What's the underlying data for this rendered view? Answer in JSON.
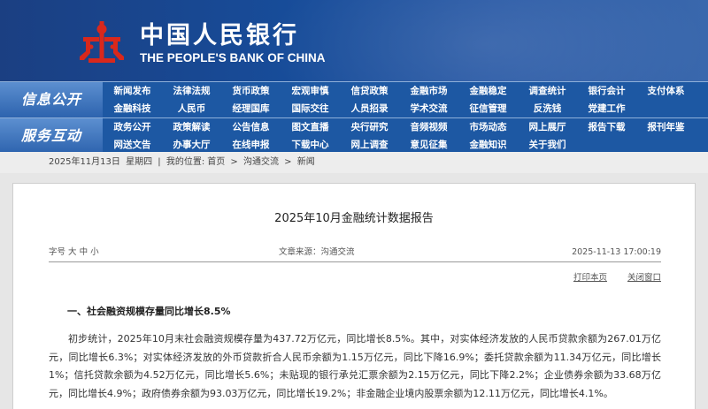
{
  "header": {
    "cn_name": "中国人民银行",
    "en_name": "THE PEOPLE'S BANK OF CHINA"
  },
  "nav": {
    "row1_label": "信息公开",
    "row2_label": "服务互动",
    "row1_items": [
      [
        "新闻发布",
        "法律法规",
        "货币政策",
        "宏观审慎",
        "信贷政策",
        "金融市场",
        "金融稳定",
        "调查统计",
        "银行会计",
        "支付体系"
      ],
      [
        "金融科技",
        "人民币",
        "经理国库",
        "国际交往",
        "人员招录",
        "学术交流",
        "征信管理",
        "反洗钱",
        "党建工作",
        ""
      ]
    ],
    "row2_items": [
      [
        "政务公开",
        "政策解读",
        "公告信息",
        "图文直播",
        "央行研究",
        "音频视频",
        "市场动态",
        "网上展厅",
        "报告下载",
        "报刊年鉴"
      ],
      [
        "网送文告",
        "办事大厅",
        "在线申报",
        "下载中心",
        "网上调查",
        "意见征集",
        "金融知识",
        "关于我们",
        "",
        ""
      ]
    ]
  },
  "breadcrumb": {
    "date": "2025年11月13日",
    "weekday": "星期四",
    "sep1": "|",
    "location_label": "我的位置:",
    "home": "首页",
    "sep2": ">",
    "section": "沟通交流",
    "sep3": ">",
    "current": "新闻"
  },
  "article": {
    "title": "2025年10月金融统计数据报告",
    "font_size_label": "字号",
    "font_large": "大",
    "font_medium": "中",
    "font_small": "小",
    "source": "文章来源：沟通交流",
    "datetime": "2025-11-13 17:00:19",
    "print_label": "打印本页",
    "close_label": "关闭窗口",
    "heading1": "一、社会融资规模存量同比增长8.5%",
    "paragraph1": "初步统计，2025年10月末社会融资规模存量为437.72万亿元，同比增长8.5%。其中，对实体经济发放的人民币贷款余额为267.01万亿元，同比增长6.3%；对实体经济发放的外币贷款折合人民币余额为1.15万亿元，同比下降16.9%；委托贷款余额为11.34万亿元，同比增长1%；信托贷款余额为4.52万亿元，同比增长5.6%；未贴现的银行承兑汇票余额为2.15万亿元，同比下降2.2%；企业债券余额为33.68万亿元，同比增长4.9%；政府债券余额为93.03万亿元，同比增长19.2%；非金融企业境内股票余额为12.11万亿元，同比增长4.1%。"
  },
  "colors": {
    "banner": "#174c99",
    "nav": "#1d58a3",
    "logo_red": "#d9281c"
  }
}
